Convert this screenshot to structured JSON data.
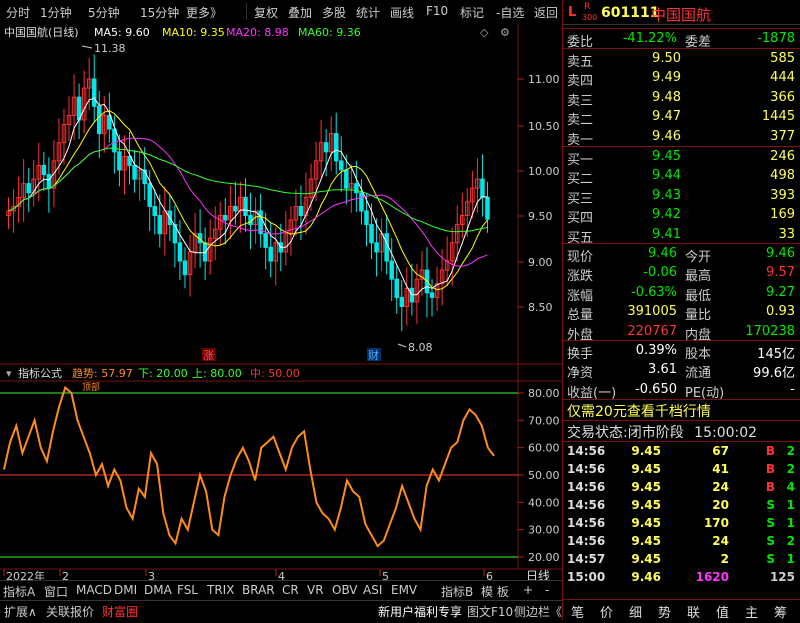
{
  "topbar": {
    "items": [
      "分时",
      "1分钟",
      "5分钟",
      "15分钟",
      "更多》",
      "复权",
      "叠加",
      "多股",
      "统计",
      "画线",
      "F10",
      "标记",
      "-自选",
      "返回"
    ],
    "mode_badge_l": "L",
    "mode_badge_r": "R",
    "mode_badge_sub": "300",
    "stock_code": "601111",
    "stock_name": "中国国航"
  },
  "chart": {
    "title": "中国国航(日线)",
    "ma": [
      {
        "label": "MA5: 9.60",
        "color": "#ffffff"
      },
      {
        "label": "MA10: 9.35",
        "color": "#ffff00"
      },
      {
        "label": "MA20: 8.98",
        "color": "#ff33ff"
      },
      {
        "label": "MA60: 9.36",
        "color": "#33ff33"
      }
    ],
    "price_axis": [
      "11.00",
      "10.50",
      "10.00",
      "9.50",
      "9.00",
      "8.50"
    ],
    "high_label": "11.38",
    "low_label": "8.08",
    "event_marks": [
      "涨",
      "财"
    ],
    "indicator_name": "指标公式",
    "indicator_values": [
      {
        "label": "趋势: 57.97",
        "color": "#ff8c1a"
      },
      {
        "label": "下: 20.00",
        "color": "#33ff33"
      },
      {
        "label": "上: 80.00",
        "color": "#33ff33"
      },
      {
        "label": "中: 50.00",
        "color": "#ff3333"
      }
    ],
    "indicator_axis": [
      "80.00",
      "70.00",
      "60.00",
      "50.00",
      "40.00",
      "30.00",
      "20.00"
    ],
    "peak_note": "顶部",
    "date_labels": [
      "2022年",
      "2",
      "3",
      "4",
      "5",
      "6"
    ],
    "period_label": "日线"
  },
  "tabs": {
    "row1": [
      "指标A",
      "窗口",
      "MACD",
      "DMI",
      "DMA",
      "FSL",
      "TRIX",
      "BRAR",
      "CR",
      "VR",
      "OBV",
      "ASI",
      "EMV",
      "指标B",
      "模 板",
      "+",
      "-"
    ],
    "row2": [
      "扩展∧",
      "关联报价",
      "财富圈",
      "新用户福利专享",
      "图文F10",
      "侧边栏《"
    ]
  },
  "quote": {
    "weibi_label": "委比",
    "weibi": "-41.22%",
    "weicha_label": "委差",
    "weicha": "-1878",
    "asks": [
      {
        "label": "卖五",
        "price": "9.50",
        "vol": "585"
      },
      {
        "label": "卖四",
        "price": "9.49",
        "vol": "444"
      },
      {
        "label": "卖三",
        "price": "9.48",
        "vol": "366"
      },
      {
        "label": "卖二",
        "price": "9.47",
        "vol": "1445"
      },
      {
        "label": "卖一",
        "price": "9.46",
        "vol": "377"
      }
    ],
    "bids": [
      {
        "label": "买一",
        "price": "9.45",
        "vol": "246"
      },
      {
        "label": "买二",
        "price": "9.44",
        "vol": "498"
      },
      {
        "label": "买三",
        "price": "9.43",
        "vol": "393"
      },
      {
        "label": "买四",
        "price": "9.42",
        "vol": "169"
      },
      {
        "label": "买五",
        "price": "9.41",
        "vol": "33"
      }
    ],
    "stats": [
      {
        "l1": "现价",
        "v1": "9.46",
        "c1": "green",
        "l2": "今开",
        "v2": "9.46",
        "c2": "green"
      },
      {
        "l1": "涨跌",
        "v1": "-0.06",
        "c1": "green",
        "l2": "最高",
        "v2": "9.57",
        "c2": "red"
      },
      {
        "l1": "涨幅",
        "v1": "-0.63%",
        "c1": "green",
        "l2": "最低",
        "v2": "9.27",
        "c2": "green"
      },
      {
        "l1": "总量",
        "v1": "391005",
        "c1": "yellow",
        "l2": "量比",
        "v2": "0.93",
        "c2": "yellow"
      },
      {
        "l1": "外盘",
        "v1": "220767",
        "c1": "red",
        "l2": "内盘",
        "v2": "170238",
        "c2": "green"
      }
    ],
    "stats2": [
      {
        "l1": "换手",
        "v1": "0.39%",
        "l2": "股本",
        "v2": "145亿"
      },
      {
        "l1": "净资",
        "v1": "3.61",
        "l2": "流通",
        "v2": "99.6亿"
      },
      {
        "l1": "收益(一)",
        "v1": "-0.650",
        "l2": "PE(动)",
        "v2": "-"
      }
    ],
    "promo": "仅需20元查看千档行情",
    "status_label": "交易状态:",
    "status": "闭市阶段",
    "status_time": "15:00:02",
    "ticks": [
      {
        "time": "14:56",
        "price": "9.45",
        "vol": "67",
        "side": "B",
        "n": "2"
      },
      {
        "time": "14:56",
        "price": "9.45",
        "vol": "41",
        "side": "B",
        "n": "2"
      },
      {
        "time": "14:56",
        "price": "9.45",
        "vol": "24",
        "side": "B",
        "n": "4"
      },
      {
        "time": "14:56",
        "price": "9.45",
        "vol": "20",
        "side": "S",
        "n": "1"
      },
      {
        "time": "14:56",
        "price": "9.45",
        "vol": "170",
        "side": "S",
        "n": "1"
      },
      {
        "time": "14:56",
        "price": "9.45",
        "vol": "24",
        "side": "S",
        "n": "2"
      },
      {
        "time": "14:57",
        "price": "9.45",
        "vol": "2",
        "side": "S",
        "n": "1"
      },
      {
        "time": "15:00",
        "price": "9.46",
        "vol": "1620",
        "side": "",
        "n": "125"
      }
    ],
    "bottom_tabs": [
      "笔",
      "价",
      "细",
      "势",
      "联",
      "值",
      "主",
      "筹"
    ]
  },
  "colors": {
    "up": "#ff3333",
    "down": "#00e6e6",
    "bg": "#000000",
    "border": "#7a1010"
  }
}
